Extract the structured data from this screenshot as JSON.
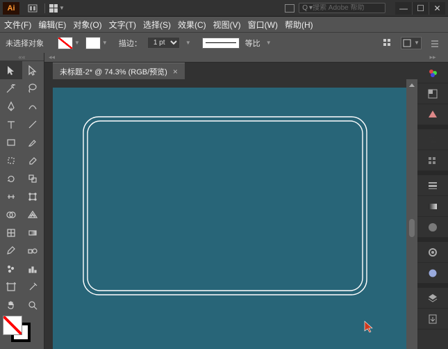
{
  "app": {
    "logo_text": "Ai"
  },
  "search": {
    "placeholder": "搜索 Adobe 帮助",
    "icon_label": "Q"
  },
  "menus": [
    "文件(F)",
    "编辑(E)",
    "对象(O)",
    "文字(T)",
    "选择(S)",
    "效果(C)",
    "视图(V)",
    "窗口(W)",
    "帮助(H)"
  ],
  "control": {
    "selection_label": "未选择对象",
    "stroke_label": "描边：",
    "stroke_value": "1 pt",
    "dash_label": "等比"
  },
  "tab": {
    "title": "未标题-2* @ 74.3% (RGB/预览)",
    "close": "×"
  },
  "colors": {
    "canvas_bg": "#286578",
    "app_bg": "#323232",
    "panel_bg": "#535353"
  },
  "artwork": {
    "type": "rounded-rectangle",
    "double_stroke": true,
    "stroke_color": "#ffffff"
  }
}
